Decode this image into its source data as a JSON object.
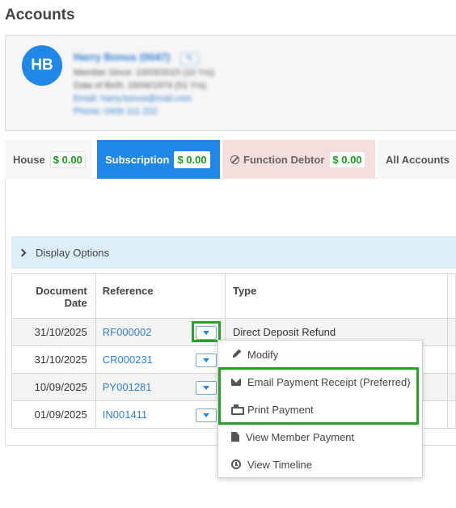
{
  "page": {
    "title": "Accounts"
  },
  "member": {
    "initials": "HB",
    "name": "Harry Bonus (0047)",
    "edit_label": "✎",
    "lines": [
      "Member Since: 10/03/2015 (10 Yrs)",
      "Date of Birth: 26/06/1974 (51 Yrs)",
      "Email: harry.bonus@mail.com",
      "Phone: 0400 111 222"
    ]
  },
  "tabs": [
    {
      "label": "House",
      "balance": "$ 0.00"
    },
    {
      "label": "Subscription",
      "balance": "$ 0.00"
    },
    {
      "label": "Function Debtor",
      "balance": "$ 0.00",
      "icon": "ban-icon"
    },
    {
      "label": "All Accounts"
    }
  ],
  "display_options": {
    "label": "Display Options"
  },
  "table": {
    "headers": {
      "date_line1": "Document",
      "date_line2": "Date",
      "reference": "Reference",
      "type": "Type"
    },
    "rows": [
      {
        "date": "31/10/2025",
        "reference": "RF000002",
        "type": "Direct Deposit Refund"
      },
      {
        "date": "31/10/2025",
        "reference": "CR000231",
        "type": ""
      },
      {
        "date": "10/09/2025",
        "reference": "PY001281",
        "type": ""
      },
      {
        "date": "01/09/2025",
        "reference": "IN001411",
        "type": ""
      }
    ]
  },
  "menu": {
    "items": [
      {
        "label": "Modify",
        "icon": "pencil-icon"
      },
      {
        "label": "Email Payment Receipt (Preferred)",
        "icon": "envelope-icon"
      },
      {
        "label": "Print Payment",
        "icon": "printer-icon"
      },
      {
        "label": "View Member Payment",
        "icon": "file-icon"
      },
      {
        "label": "View Timeline",
        "icon": "clock-icon"
      }
    ]
  },
  "colors": {
    "primary": "#1f87e6",
    "highlight": "#2aa02a",
    "badge_text": "#1a9a1a",
    "function_tab_bg": "#f4dede"
  }
}
